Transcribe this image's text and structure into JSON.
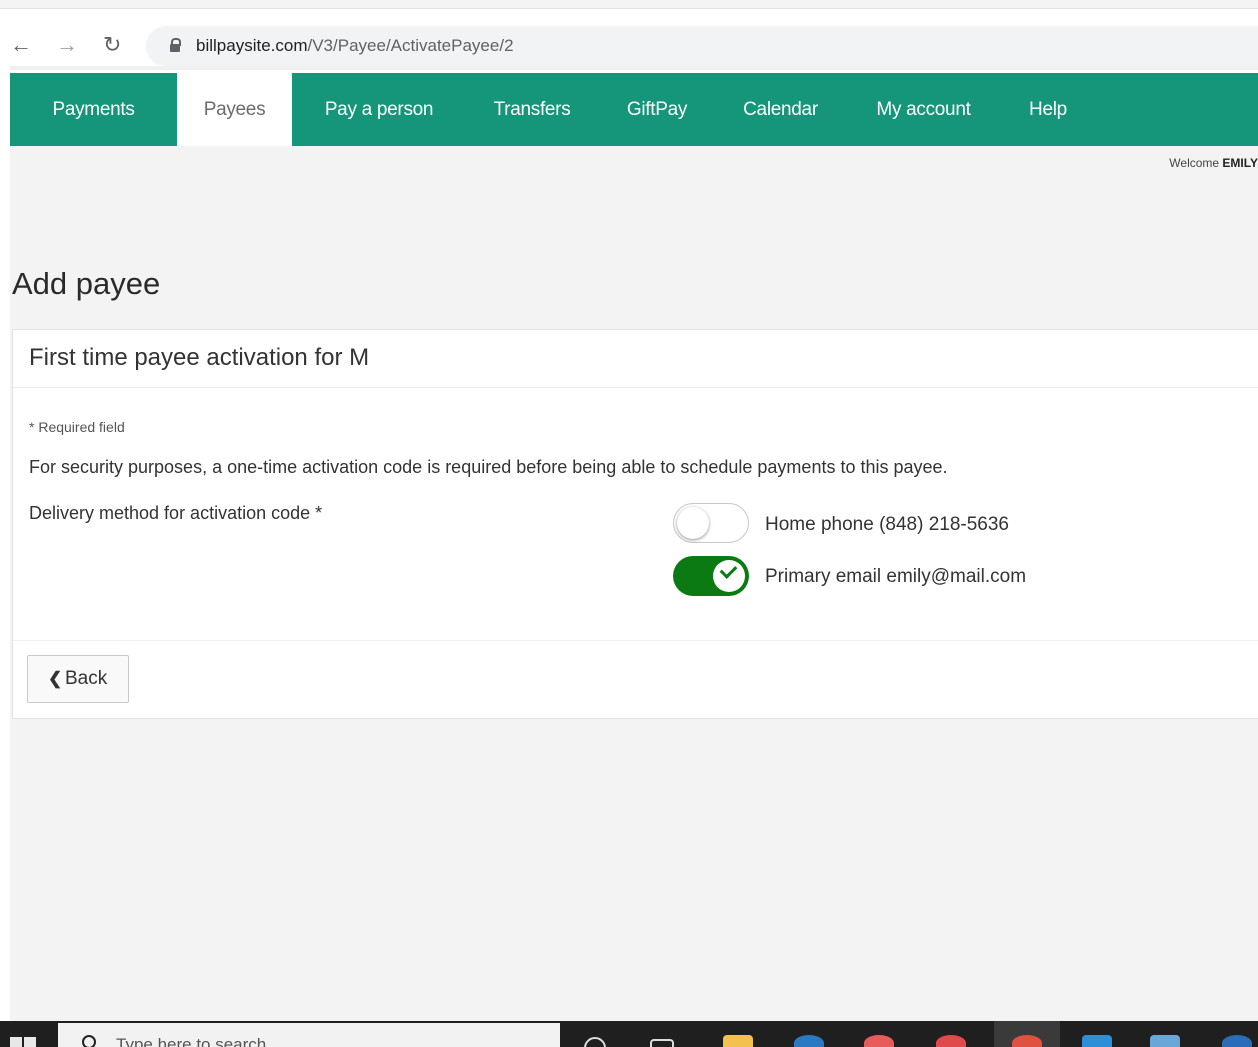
{
  "browser": {
    "url_host": "billpaysite.com",
    "url_path": "/V3/Payee/ActivatePayee/2"
  },
  "nav": {
    "tabs": [
      {
        "label": "Payments",
        "active": false
      },
      {
        "label": "Payees",
        "active": true
      },
      {
        "label": "Pay a person",
        "active": false
      },
      {
        "label": "Transfers",
        "active": false
      },
      {
        "label": "GiftPay",
        "active": false
      },
      {
        "label": "Calendar",
        "active": false
      },
      {
        "label": "My account",
        "active": false
      },
      {
        "label": "Help",
        "active": false
      }
    ]
  },
  "header": {
    "welcome": "Welcome",
    "user": "EMILY"
  },
  "page": {
    "title": "Add payee"
  },
  "card": {
    "title": "First time payee activation for M",
    "required_note": "* Required field",
    "security_text": "For security purposes, a one-time activation code is required before being able to schedule payments to this payee.",
    "delivery_label": "Delivery method for activation code *",
    "options": [
      {
        "label": "Home phone (848) 218-5636",
        "selected": false
      },
      {
        "label": "Primary email emily@mail.com",
        "selected": true
      }
    ],
    "back_label": "Back"
  },
  "taskbar": {
    "search_placeholder": "Type here to search"
  },
  "colors": {
    "brand": "#15957a",
    "toggle_on": "#0b7a12"
  }
}
